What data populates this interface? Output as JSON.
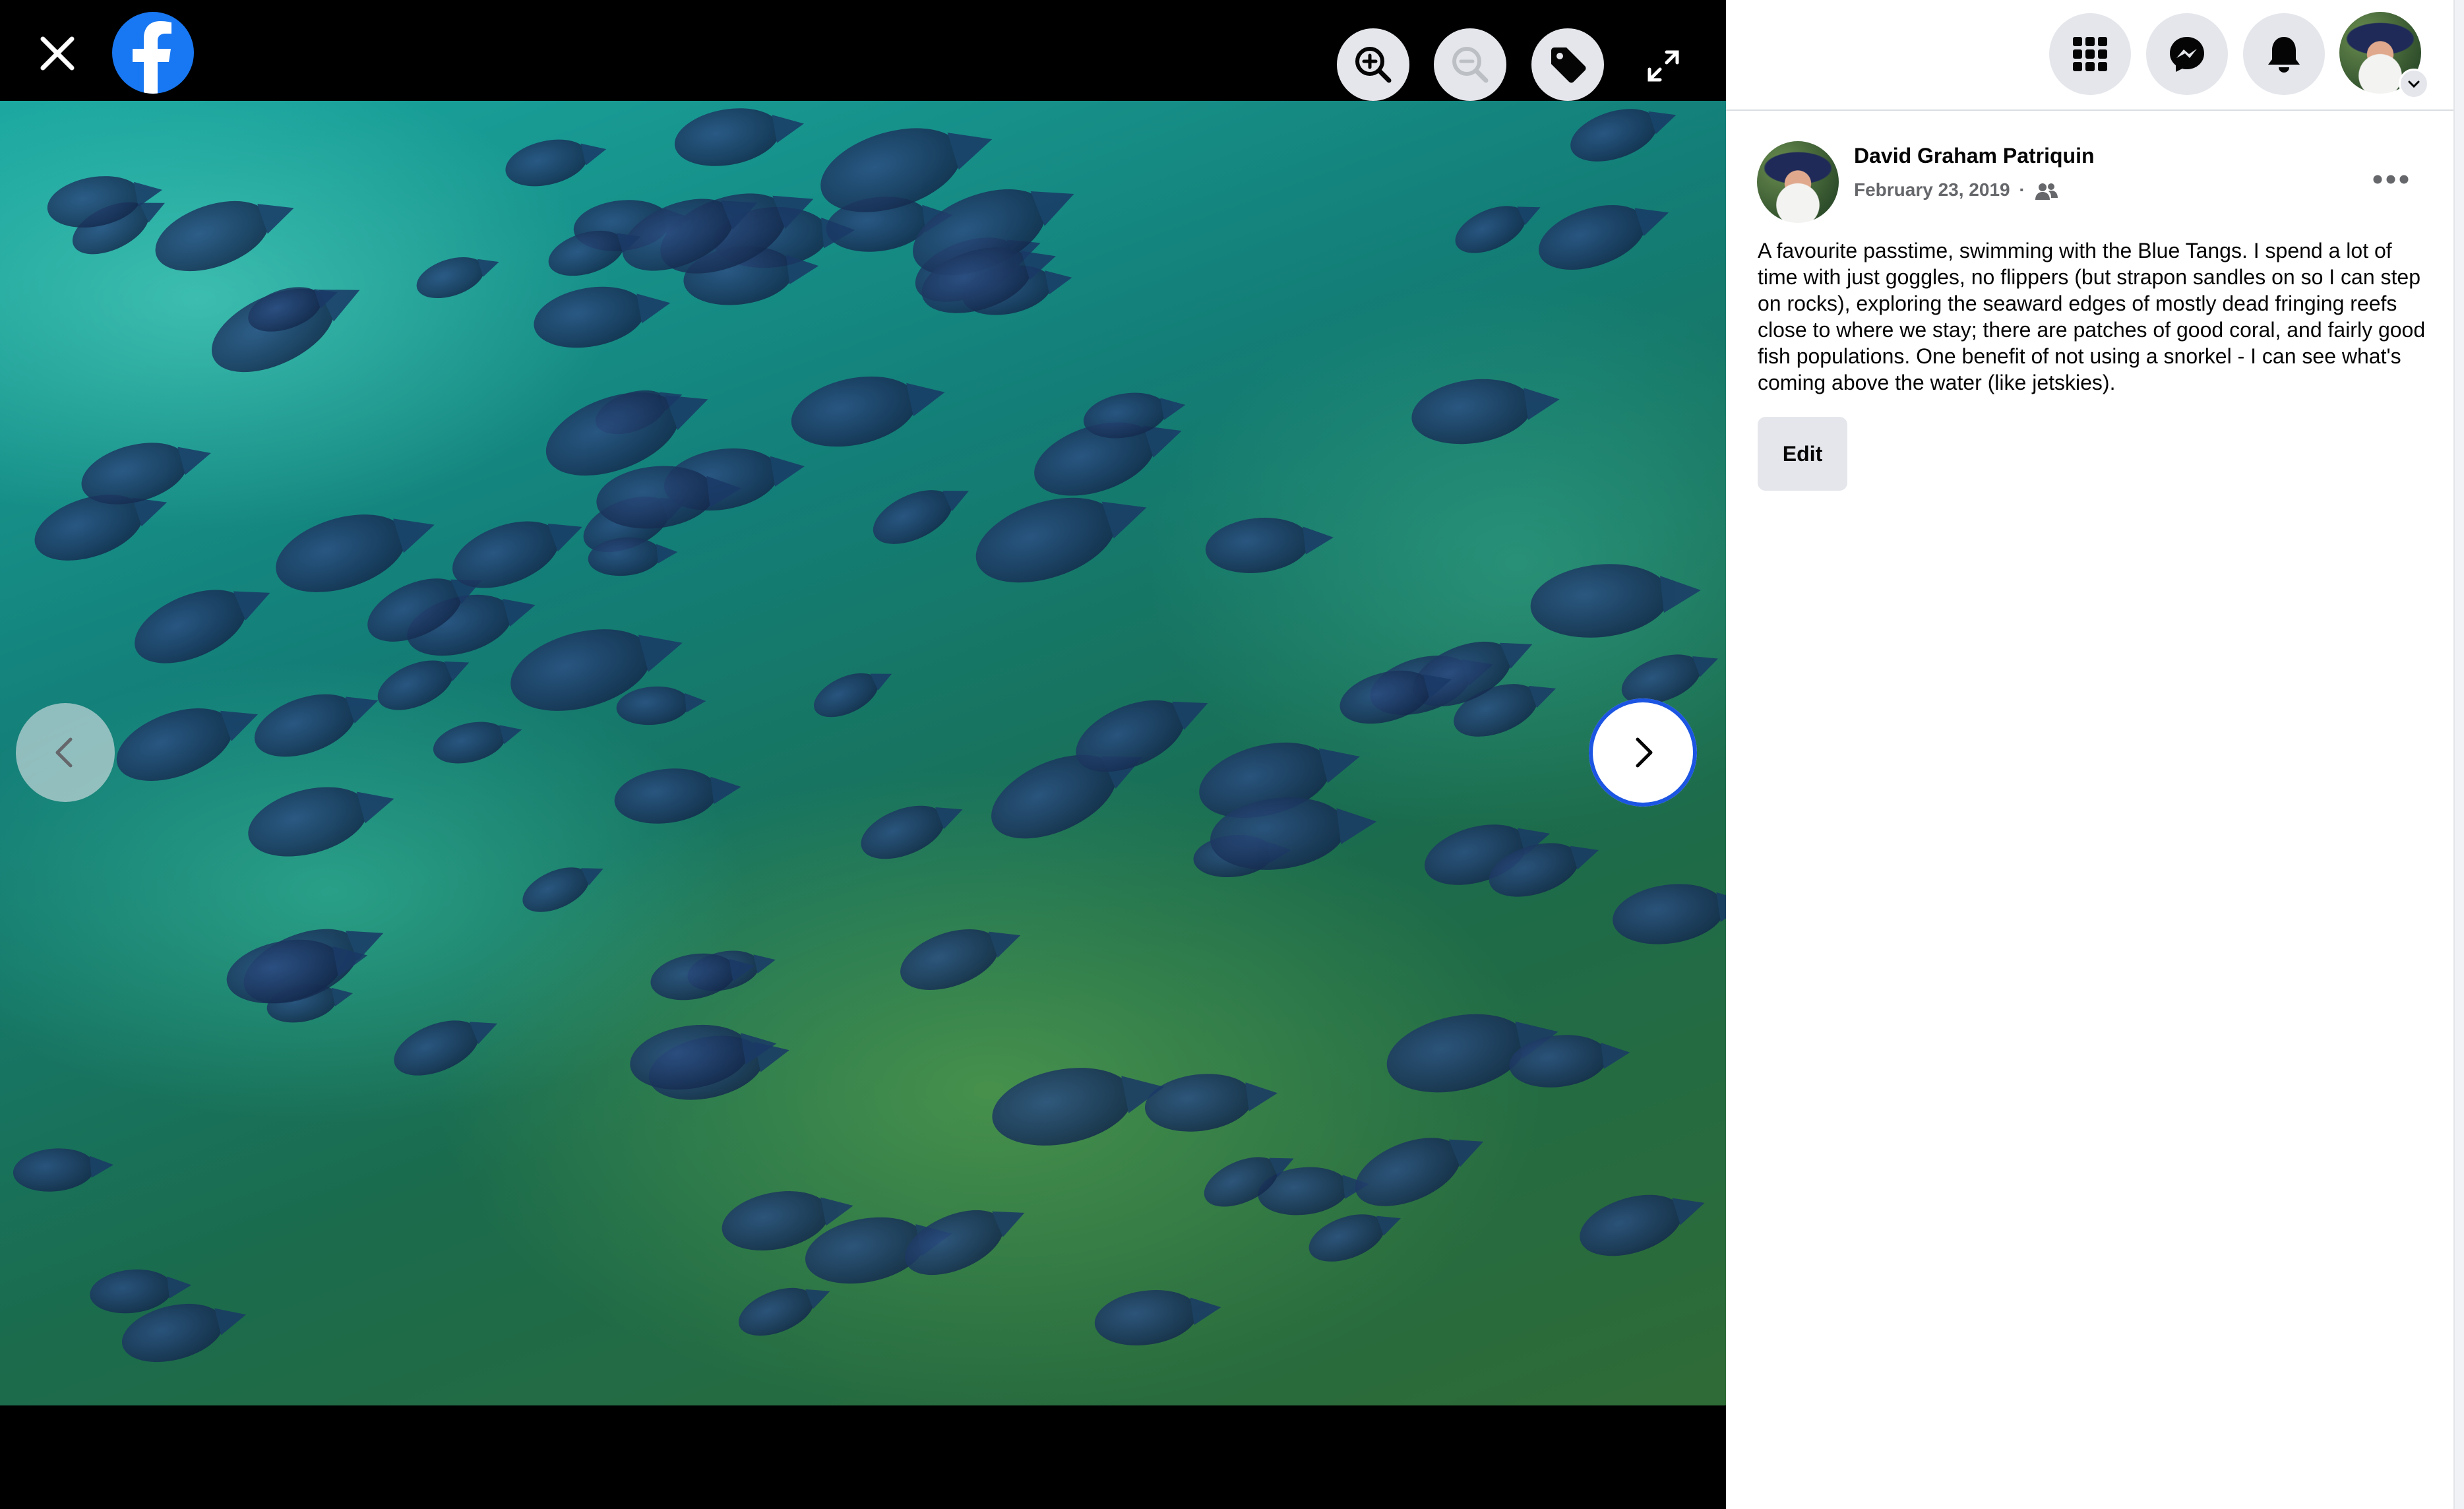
{
  "viewer": {
    "photo_description": "",
    "close_icon": "close-icon",
    "logo": "facebook-logo",
    "tools": [
      "zoom-in-icon",
      "zoom-out-icon",
      "tag-icon",
      "fullscreen-icon"
    ],
    "nav": [
      "chevron-left-icon",
      "chevron-right-icon"
    ]
  },
  "topbar": {
    "icons": [
      "menu-grid-icon",
      "messenger-icon",
      "bell-icon",
      "account-avatar"
    ]
  },
  "post": {
    "author": "David Graham Patriquin",
    "date": "February 23, 2019",
    "separator": "·",
    "audience_icon": "friends-icon",
    "text": "A favourite passtime, swimming with the Blue Tangs. I spend a lot of time with just goggles, no flippers (but strapon sandles on so I can step on rocks), exploring the seaward edges of mostly dead fringing reefs close to where we stay; there are patches of good coral, and fairly good fish populations. One benefit of not using a snorkel - I can see what's coming above the water (like jetskies).",
    "edit_label": "Edit"
  },
  "colors": {
    "facebook_blue": "#1877f2",
    "focus_ring": "#1b55e2",
    "secondary_button": "#e4e6eb"
  }
}
